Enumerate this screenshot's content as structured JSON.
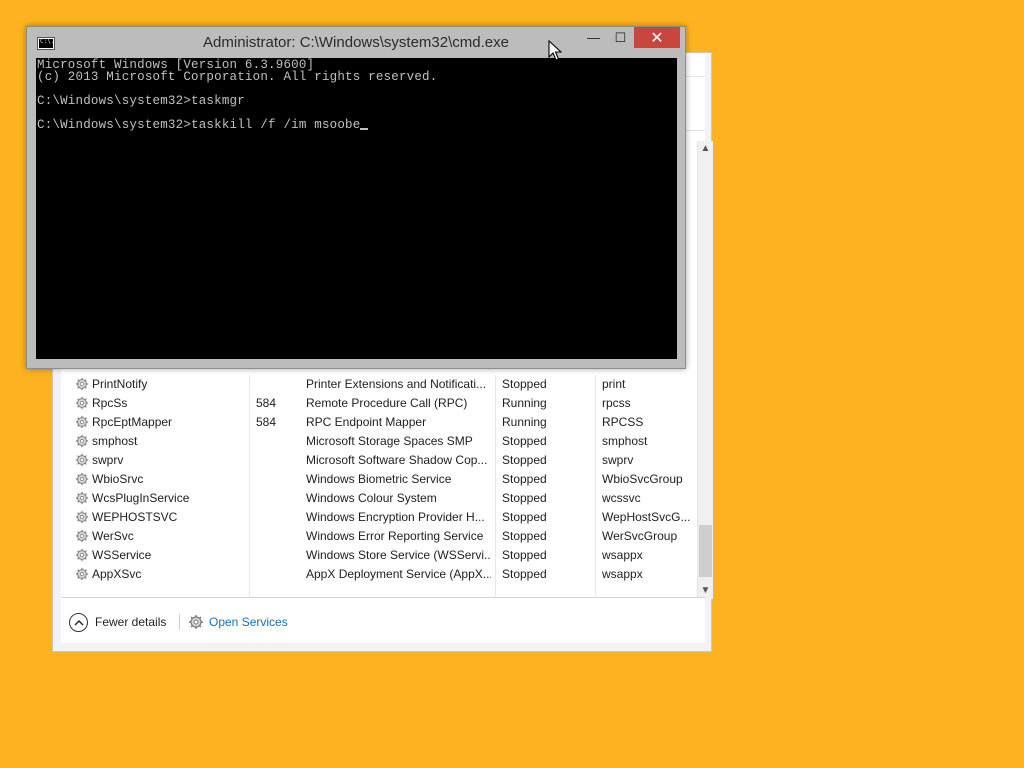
{
  "task_manager": {
    "services": [
      {
        "name": "PrintNotify",
        "pid": "",
        "description": "Printer Extensions and Notificati...",
        "status": "Stopped",
        "group": "print"
      },
      {
        "name": "RpcSs",
        "pid": "584",
        "description": "Remote Procedure Call (RPC)",
        "status": "Running",
        "group": "rpcss"
      },
      {
        "name": "RpcEptMapper",
        "pid": "584",
        "description": "RPC Endpoint Mapper",
        "status": "Running",
        "group": "RPCSS"
      },
      {
        "name": "smphost",
        "pid": "",
        "description": "Microsoft Storage Spaces SMP",
        "status": "Stopped",
        "group": "smphost"
      },
      {
        "name": "swprv",
        "pid": "",
        "description": "Microsoft Software Shadow Cop...",
        "status": "Stopped",
        "group": "swprv"
      },
      {
        "name": "WbioSrvc",
        "pid": "",
        "description": "Windows Biometric Service",
        "status": "Stopped",
        "group": "WbioSvcGroup"
      },
      {
        "name": "WcsPlugInService",
        "pid": "",
        "description": "Windows Colour System",
        "status": "Stopped",
        "group": "wcssvc"
      },
      {
        "name": "WEPHOSTSVC",
        "pid": "",
        "description": "Windows Encryption Provider H...",
        "status": "Stopped",
        "group": "WepHostSvcG..."
      },
      {
        "name": "WerSvc",
        "pid": "",
        "description": "Windows Error Reporting Service",
        "status": "Stopped",
        "group": "WerSvcGroup"
      },
      {
        "name": "WSService",
        "pid": "",
        "description": "Windows Store Service (WSServi...",
        "status": "Stopped",
        "group": "wsappx"
      },
      {
        "name": "AppXSvc",
        "pid": "",
        "description": "AppX Deployment Service (AppX...",
        "status": "Stopped",
        "group": "wsappx"
      }
    ],
    "footer": {
      "fewer_details": "Fewer details",
      "open_services": "Open Services"
    }
  },
  "cmd": {
    "title": "Administrator: C:\\Windows\\system32\\cmd.exe",
    "icon_label": "C:\\.",
    "lines": [
      "Microsoft Windows [Version 6.3.9600]",
      "(c) 2013 Microsoft Corporation. All rights reserved.",
      "",
      "C:\\Windows\\system32>taskmgr",
      "",
      "C:\\Windows\\system32>taskkill /f /im msoobe"
    ],
    "buttons": {
      "minimize": "—",
      "maximize": "☐",
      "close": "✕"
    }
  },
  "icons": {
    "service": "gear-icon",
    "fewer": "chevron-up-icon",
    "services": "services-gear-icon",
    "cursor": "mouse-pointer-icon"
  }
}
